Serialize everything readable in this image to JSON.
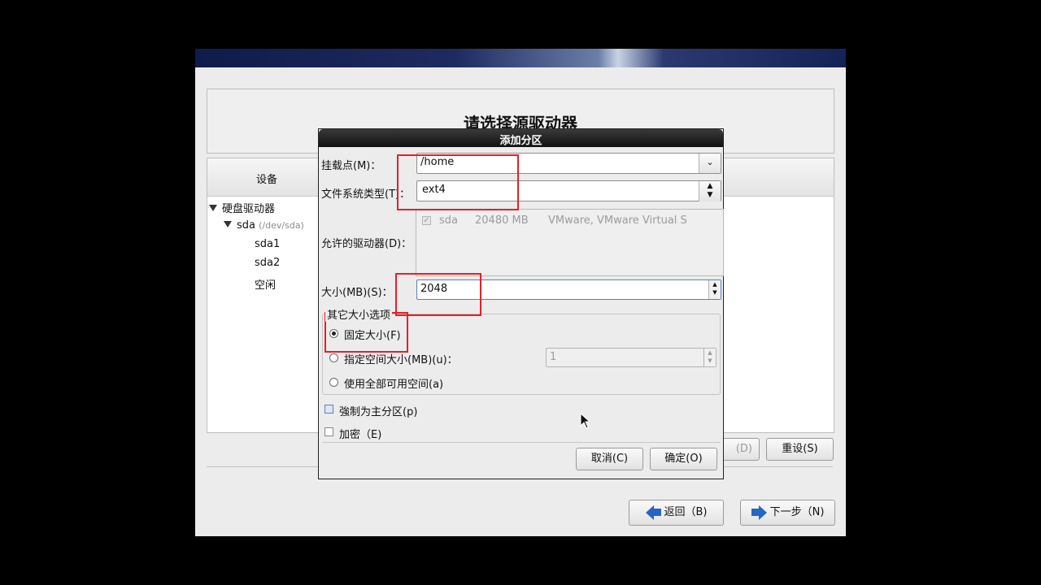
{
  "installer": {
    "title": "请选择源驱动器",
    "device_header": "设备",
    "tree": {
      "group": "硬盘驱动器",
      "disk": "sda",
      "disk_path": "(/dev/sda)",
      "partitions": [
        "sda1",
        "sda2",
        "空闲"
      ]
    },
    "buttons": {
      "delete": "(D)",
      "reset": "重设(S)",
      "back": "返回（B)",
      "next": "下一步（N)"
    }
  },
  "dialog": {
    "title": "添加分区",
    "mount_label": "挂载点(M)：",
    "mount_value": "/home",
    "fstype_label": "文件系统类型(T)：",
    "fstype_value": "ext4",
    "drives_label": "允许的驱动器(D)：",
    "drive": {
      "name": "sda",
      "size": "20480 MB",
      "model": "VMware, VMware Virtual S"
    },
    "size_label": "大小(MB)(S)：",
    "size_value": "2048",
    "other_size_group": "其它大小选项",
    "options": [
      {
        "label": "固定大小(F)",
        "selected": true
      },
      {
        "label": "指定空间大小(MB)(u)：",
        "selected": false
      },
      {
        "label": "使用全部可用空间(a)",
        "selected": false
      }
    ],
    "max_size_value": "1",
    "force_primary_label": "強制为主分区(p)",
    "encrypt_label": "加密（E)",
    "cancel_label": "取消(C)",
    "ok_label": "确定(O)"
  },
  "colors": {
    "highlight_box": "#e3202a",
    "accent_arrow": "#2466c2"
  }
}
